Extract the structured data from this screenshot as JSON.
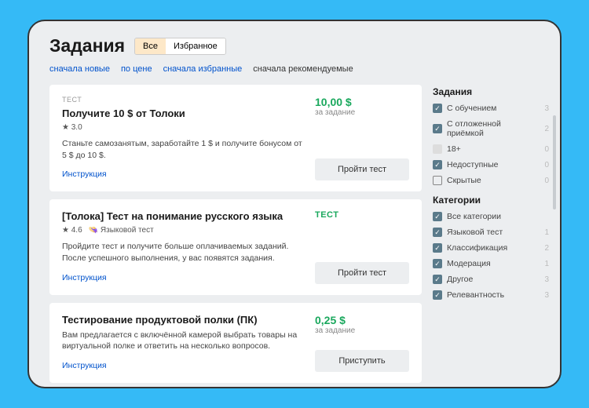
{
  "header": {
    "title": "Задания"
  },
  "tabs": [
    {
      "label": "Все",
      "active": true
    },
    {
      "label": "Избранное",
      "active": false
    }
  ],
  "sorts": [
    {
      "label": "сначала новые",
      "active": false
    },
    {
      "label": "по цене",
      "active": false
    },
    {
      "label": "сначала избранные",
      "active": false
    },
    {
      "label": "сначала рекомендуемые",
      "active": true
    }
  ],
  "tasks": [
    {
      "badge": "ТЕСТ",
      "title": "Получите 10 $ от Толоки",
      "rating": "★ 3.0",
      "tag": "",
      "desc": "Станьте самозанятым, заработайте 1 $ и получите бонусом от 5 $ до 10 $.",
      "link": "Инструкция",
      "price": "10,00 $",
      "priceLabel": "за задание",
      "testBadge": "",
      "button": "Пройти тест"
    },
    {
      "badge": "",
      "title": "[Толока] Тест на понимание русского языка",
      "rating": "★ 4.6",
      "tag": "👒 Языковой тест",
      "desc": "Пройдите тест и получите больше оплачиваемых заданий. После успешного выполнения, у вас появятся задания.",
      "link": "Инструкция",
      "price": "",
      "priceLabel": "",
      "testBadge": "ТЕСТ",
      "button": "Пройти тест"
    },
    {
      "badge": "",
      "title": "Тестирование продуктовой полки (ПК)",
      "rating": "",
      "tag": "",
      "desc": "Вам предлагается с включённой камерой выбрать товары на виртуальной полке и ответить на несколько вопросов.",
      "link": "Инструкция",
      "price": "0,25 $",
      "priceLabel": "за задание",
      "testBadge": "",
      "button": "Приступить"
    }
  ],
  "sidebar": {
    "sections": [
      {
        "title": "Задания",
        "filters": [
          {
            "label": "С обучением",
            "checked": true,
            "count": "3",
            "type": "chk"
          },
          {
            "label": "С отложенной приёмкой",
            "checked": true,
            "count": "2",
            "type": "chk"
          },
          {
            "label": "18+",
            "checked": false,
            "count": "0",
            "type": "badge"
          },
          {
            "label": "Недоступные",
            "checked": true,
            "count": "0",
            "type": "chk"
          },
          {
            "label": "Скрытые",
            "checked": false,
            "count": "0",
            "type": "chk"
          }
        ]
      },
      {
        "title": "Категории",
        "filters": [
          {
            "label": "Все категории",
            "checked": true,
            "count": "",
            "type": "chk"
          },
          {
            "label": "Языковой тест",
            "checked": true,
            "count": "1",
            "type": "chk"
          },
          {
            "label": "Классификация",
            "checked": true,
            "count": "2",
            "type": "chk"
          },
          {
            "label": "Модерация",
            "checked": true,
            "count": "1",
            "type": "chk"
          },
          {
            "label": "Другое",
            "checked": true,
            "count": "3",
            "type": "chk"
          },
          {
            "label": "Релевантность",
            "checked": true,
            "count": "3",
            "type": "chk"
          }
        ]
      }
    ]
  }
}
